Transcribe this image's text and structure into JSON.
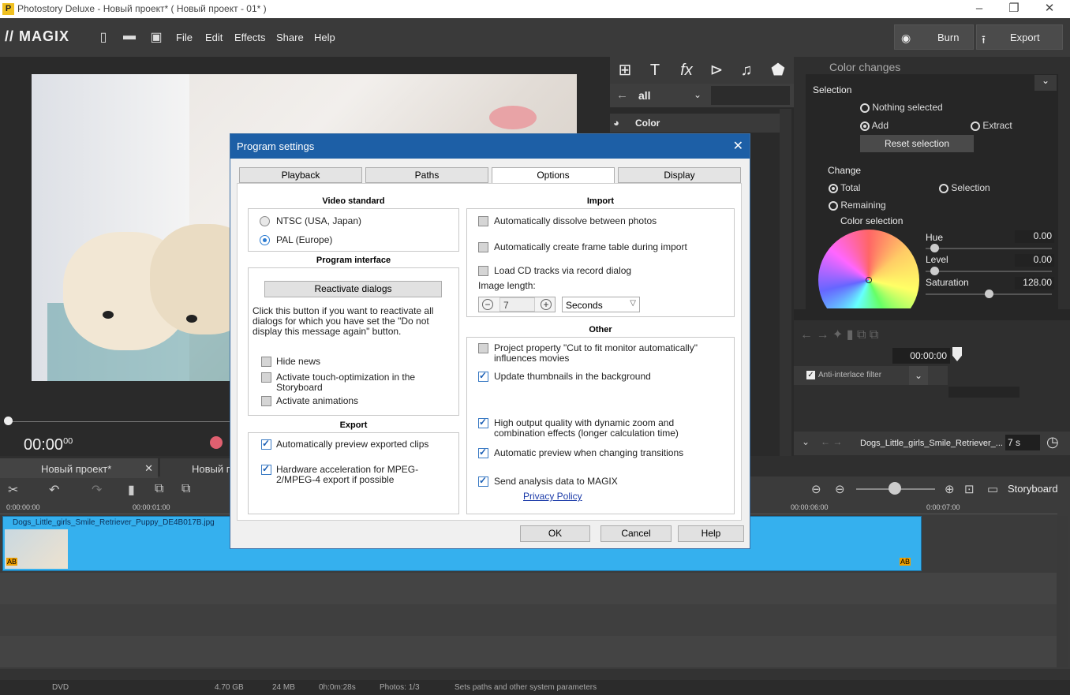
{
  "titlebar": {
    "title": "Photostory Deluxe - Новый проект* ( Новый проект - 01* )"
  },
  "menubar": {
    "logo": "MAGIX",
    "items": [
      "File",
      "Edit",
      "Effects",
      "Share",
      "Help"
    ],
    "burn": "Burn",
    "export": "Export"
  },
  "preview": {
    "timecode": "00:00",
    "timecode_frames": "00"
  },
  "media": {
    "filter": "all",
    "category": "Color"
  },
  "color_panel": {
    "title": "Color changes",
    "selection_label": "Selection",
    "nothing_selected": "Nothing selected",
    "add": "Add",
    "extract": "Extract",
    "reset": "Reset selection",
    "change_label": "Change",
    "total": "Total",
    "selection": "Selection",
    "remaining": "Remaining",
    "color_selection": "Color selection",
    "hue_label": "Hue",
    "hue_value": "0.00",
    "level_label": "Level",
    "level_value": "0.00",
    "saturation_label": "Saturation",
    "saturation_value": "128.00"
  },
  "right_lower": {
    "time": "00:00:00",
    "anti_interlace": "Anti-interlace filter",
    "clip_name": "Dogs_Little_girls_Smile_Retriever_...",
    "duration": "7 s"
  },
  "timeline": {
    "tabs": [
      "Новый проект*",
      "Новый п"
    ],
    "view": "Storyboard",
    "ruler": [
      "0:00:00:00",
      "00:00:01:00",
      "00:00:06:00",
      "0:00:07:00"
    ],
    "clip_name": "Dogs_Little_girls_Smile_Retriever_Puppy_DE4B017B.jpg"
  },
  "statusbar": {
    "format": "DVD",
    "disk": "4.70 GB",
    "size": "24 MB",
    "duration": "0h:0m:28s",
    "photos": "Photos: 1/3",
    "hint": "Sets paths and other system parameters"
  },
  "dialog": {
    "title": "Program settings",
    "tabs": [
      "Playback",
      "Paths",
      "Options",
      "Display"
    ],
    "video_standard": {
      "title": "Video standard",
      "ntsc": "NTSC (USA, Japan)",
      "pal": "PAL (Europe)"
    },
    "program_interface": {
      "title": "Program interface",
      "reactivate": "Reactivate dialogs",
      "desc": "Click this button if you want to reactivate all dialogs for which you have set the \"Do not display this message again\" button.",
      "hide_news": "Hide news",
      "touch": "Activate touch-optimization in the Storyboard",
      "animations": "Activate animations"
    },
    "export": {
      "title": "Export",
      "auto_preview": "Automatically preview exported clips",
      "hw_accel": "Hardware acceleration for MPEG-2/MPEG-4 export if possible"
    },
    "import": {
      "title": "Import",
      "dissolve": "Automatically dissolve between photos",
      "frame_table": "Automatically create frame table during import",
      "cd_tracks": "Load CD tracks via record dialog",
      "image_length": "Image length:",
      "length_value": "7",
      "unit": "Seconds"
    },
    "other": {
      "title": "Other",
      "cut_fit": "Project property \"Cut to fit monitor automatically\" influences movies",
      "thumbs": "Update thumbnails in the background",
      "hq": "High output quality with dynamic zoom and combination effects (longer calculation time)",
      "auto_preview_trans": "Automatic preview when changing transitions",
      "analysis": "Send analysis data to MAGIX",
      "privacy": "Privacy Policy"
    },
    "ok": "OK",
    "cancel": "Cancel",
    "help": "Help"
  }
}
